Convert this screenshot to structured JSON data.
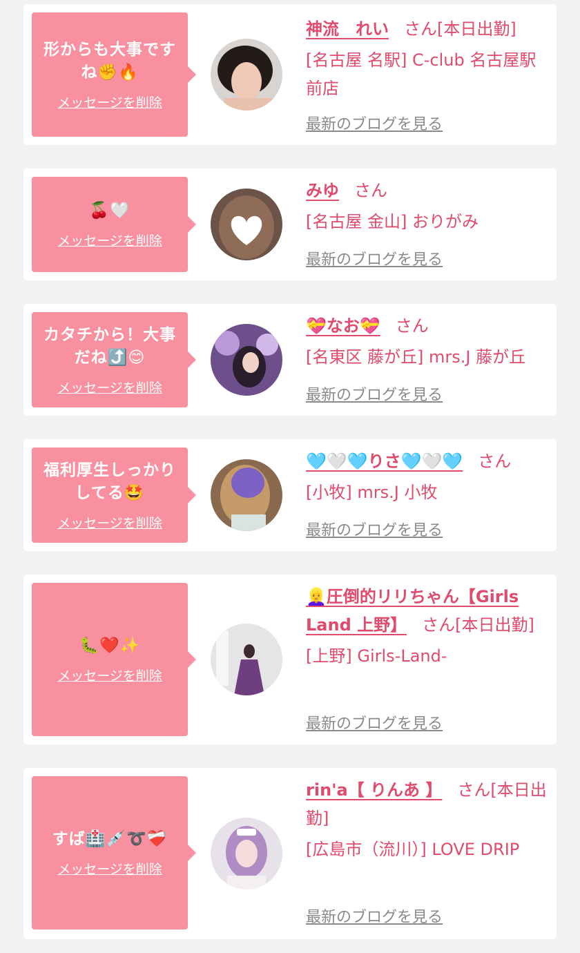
{
  "cards": [
    {
      "message": "形からも大事ですね✊🔥",
      "delete_label": "メッセージを削除",
      "name": "神流　れい",
      "san": "さん[本日出勤]",
      "shop": "[名古屋 名駅] C-club 名古屋駅前店",
      "blog_label": "最新のブログを見る"
    },
    {
      "message": "🍒🤍",
      "delete_label": "メッセージを削除",
      "name": "みゆ",
      "san": "さん",
      "shop": "[名古屋 金山] おりがみ",
      "blog_label": "最新のブログを見る"
    },
    {
      "message": "カタチから！大事だね⤴️😊",
      "delete_label": "メッセージを削除",
      "name": "💝なお💝",
      "san": "さん",
      "shop": "[名東区 藤が丘] mrs.J 藤が丘",
      "blog_label": "最新のブログを見る"
    },
    {
      "message": "福利厚生しっかりしてる🤩",
      "delete_label": "メッセージを削除",
      "name": "🩵🤍🩵りさ🩵🤍🩵",
      "san": "さん",
      "shop": "[小牧] mrs.J 小牧",
      "blog_label": "最新のブログを見る"
    },
    {
      "message": "🐛❤️✨",
      "delete_label": "メッセージを削除",
      "name": "👱‍♀️圧倒的リリちゃん【Girls Land 上野】",
      "san": "さん[本日出勤]",
      "shop": "[上野] Girls-Land-",
      "blog_label": "最新のブログを見る"
    },
    {
      "message": "すば🏥💉➰❤️‍🩹",
      "delete_label": "メッセージを削除",
      "name": "rin'a【 りんあ 】",
      "san": "さん[本日出勤]",
      "shop": "[広島市（流川）] LOVE DRIP",
      "blog_label": "最新のブログを見る"
    }
  ],
  "colors": {
    "bubble": "#f8909f",
    "accent_text": "#e04a6c",
    "link_gray": "#8a8a8a",
    "page_bg": "#f2f2f2"
  }
}
